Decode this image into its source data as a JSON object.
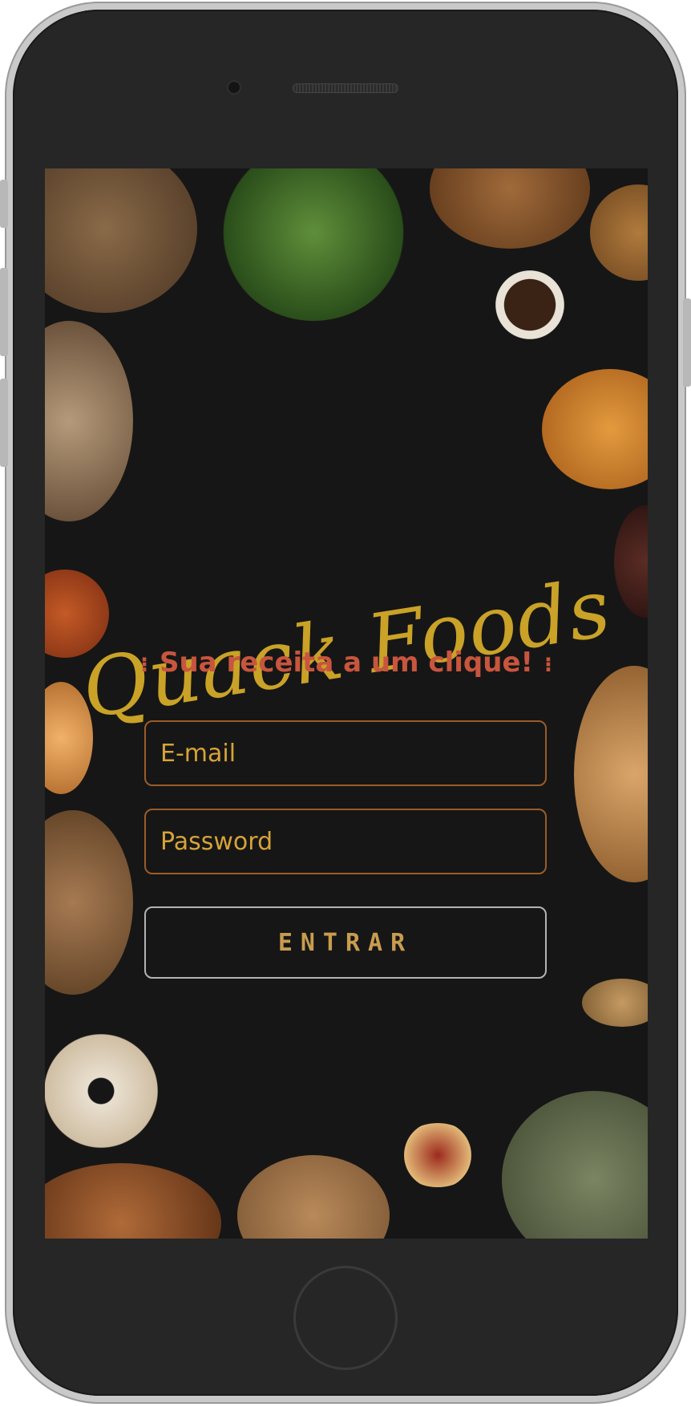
{
  "brand": {
    "name": "Quack Foods",
    "tagline": "Sua receita a um clique!"
  },
  "form": {
    "email_placeholder": "E-mail",
    "password_placeholder": "Password",
    "submit_label": "ENTRAR"
  },
  "colors": {
    "brand_gold": "#c9a227",
    "tagline_red": "#c8553d",
    "field_border": "#9a5c28",
    "placeholder": "#d6a338",
    "button_text": "#c89c4f",
    "background": "#161616"
  },
  "icons": [
    "sparkle-icon"
  ]
}
